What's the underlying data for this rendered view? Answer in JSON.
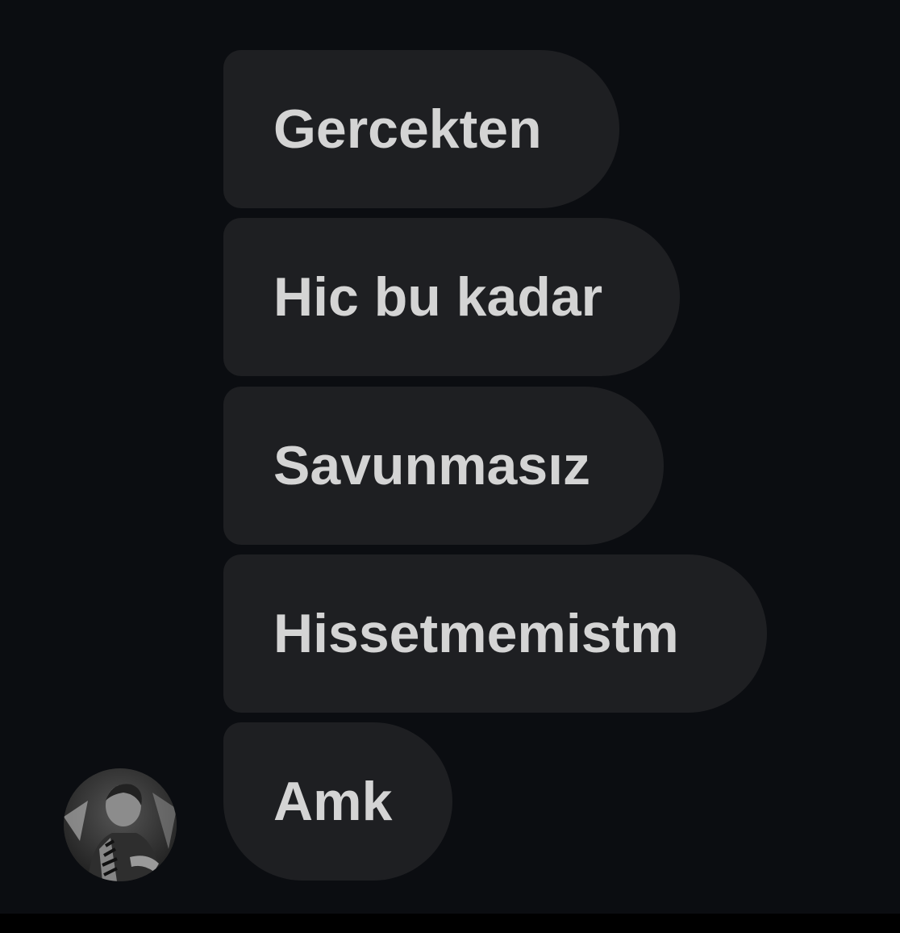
{
  "conversation": {
    "messages": [
      {
        "text": "Gercekten"
      },
      {
        "text": "Hic bu kadar"
      },
      {
        "text": "Savunmasız"
      },
      {
        "text": "Hissetmemistm"
      },
      {
        "text": "Amk"
      }
    ],
    "sender_avatar": {
      "icon": "profile-photo"
    }
  },
  "colors": {
    "background": "#0b0d11",
    "bubble": "#1e1f22",
    "text": "#d4d4d4"
  }
}
